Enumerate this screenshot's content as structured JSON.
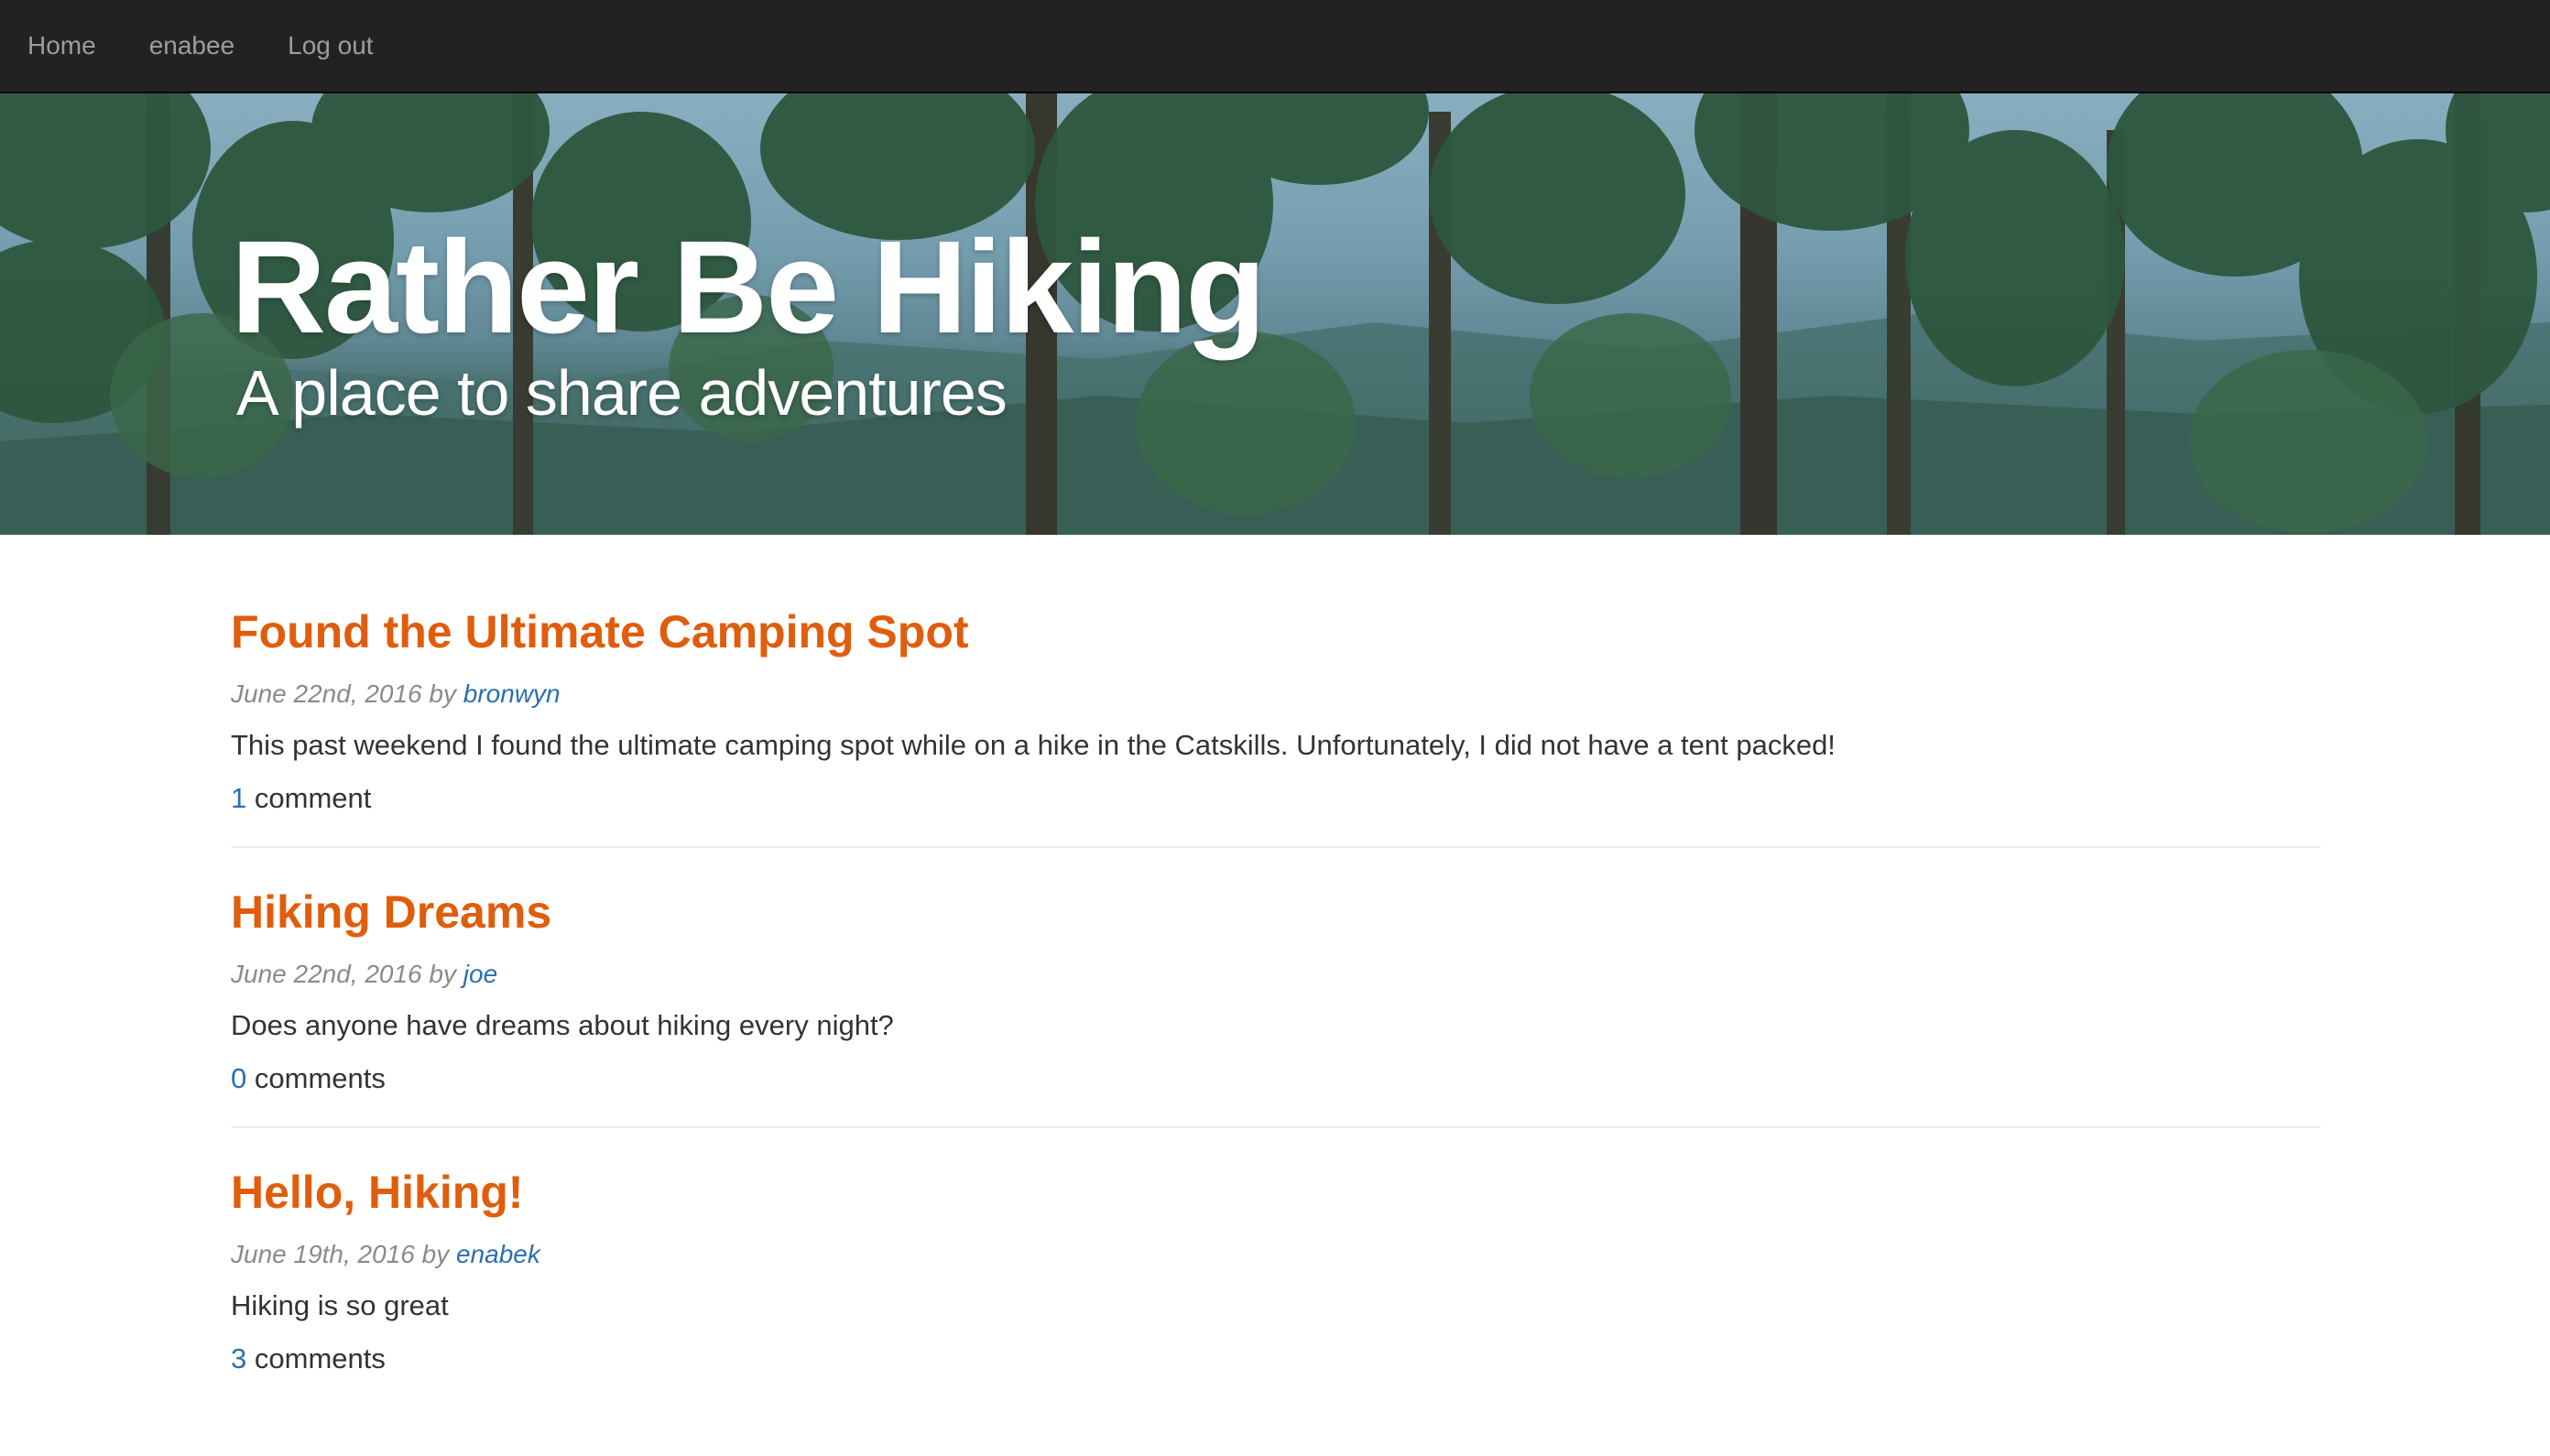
{
  "nav": {
    "items": [
      {
        "label": "Home"
      },
      {
        "label": "enabee"
      },
      {
        "label": "Log out"
      }
    ]
  },
  "hero": {
    "title": "Rather Be Hiking",
    "subtitle": "A place to share adventures"
  },
  "colors": {
    "navbar_bg": "#222222",
    "nav_text": "#9d9d9d",
    "post_title": "#e05d0c",
    "link": "#2a6fb0",
    "meta": "#8a8a8a",
    "body_text": "#333333"
  },
  "posts": [
    {
      "title": "Found the Ultimate Camping Spot",
      "date": "June 22nd, 2016",
      "by": "by",
      "author": "bronwyn",
      "body": "This past weekend I found the ultimate camping spot while on a hike in the Catskills. Unfortunately, I did not have a tent packed!",
      "comment_count": "1",
      "comment_label": "comment"
    },
    {
      "title": "Hiking Dreams",
      "date": "June 22nd, 2016",
      "by": "by",
      "author": "joe",
      "body": "Does anyone have dreams about hiking every night?",
      "comment_count": "0",
      "comment_label": "comments"
    },
    {
      "title": "Hello, Hiking!",
      "date": "June 19th, 2016",
      "by": "by",
      "author": "enabek",
      "body": "Hiking is so great",
      "comment_count": "3",
      "comment_label": "comments"
    }
  ]
}
